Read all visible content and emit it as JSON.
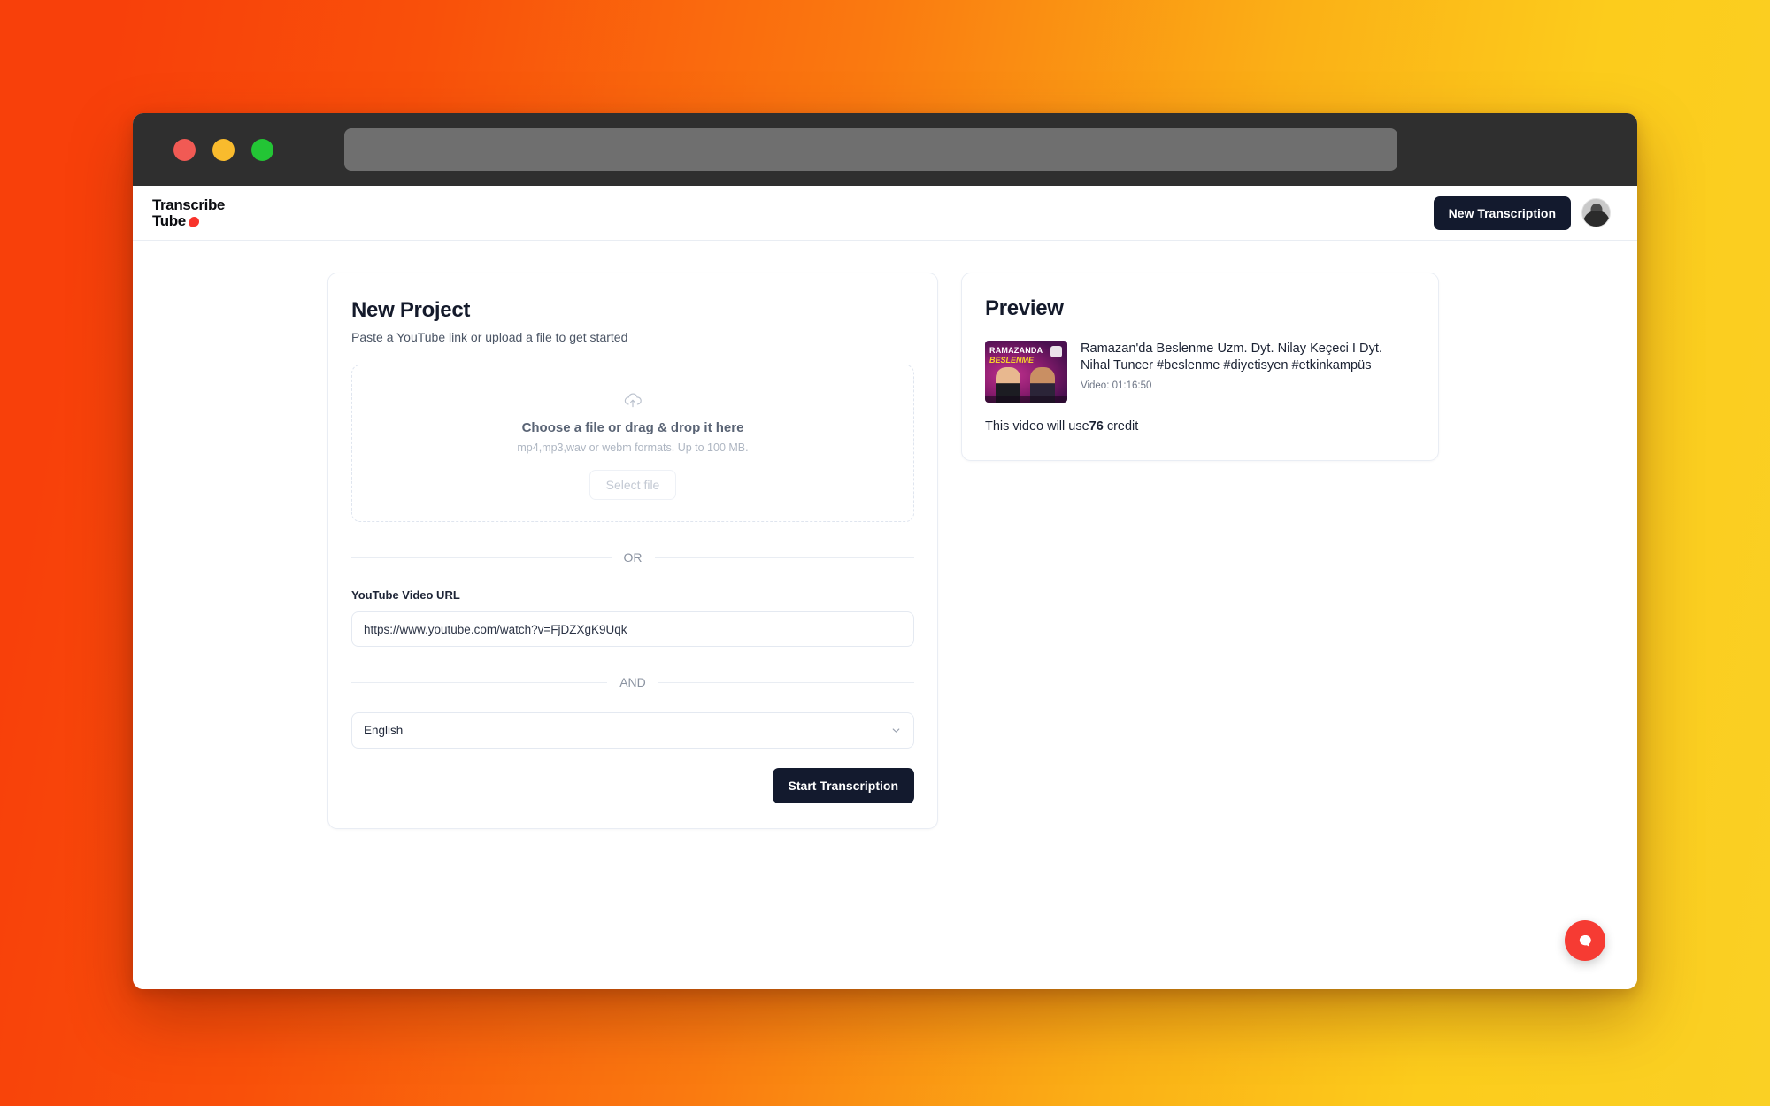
{
  "window": {
    "traffic_lights": [
      "close",
      "minimize",
      "maximize"
    ],
    "url_value": ""
  },
  "header": {
    "logo_line1": "Transcribe",
    "logo_line2": "Tube",
    "new_transcription_label": "New Transcription"
  },
  "new_project": {
    "title": "New Project",
    "subtitle": "Paste a YouTube link or upload a file to get started",
    "dropzone": {
      "icon": "cloud-upload-icon",
      "title": "Choose a file or drag & drop it here",
      "formats": "mp4,mp3,wav or webm formats. Up to 100 MB.",
      "select_button": "Select file"
    },
    "divider_or": "OR",
    "url_field": {
      "label": "YouTube Video URL",
      "value": "https://www.youtube.com/watch?v=FjDZXgK9Uqk",
      "placeholder": "https://www.youtube.com/watch?v="
    },
    "divider_and": "AND",
    "language_select": {
      "value": "English",
      "options": [
        "English"
      ]
    },
    "start_button": "Start Transcription"
  },
  "preview": {
    "title": "Preview",
    "thumbnail": {
      "line1": "RAMAZANDA",
      "line2": "BESLENME"
    },
    "video_title": "Ramazan'da Beslenme Uzm. Dyt. Nilay Keçeci I Dyt. Nihal Tuncer #beslenme #diyetisyen #etkinkampüs",
    "duration_label": "Video: 01:16:50",
    "credit_prefix": "This video will use",
    "credit_amount": "76",
    "credit_suffix": " credit"
  },
  "chat_widget": {
    "icon": "chat-bubble-icon",
    "color": "#f63b33"
  },
  "colors": {
    "accent_dark": "#131a2e",
    "brand_red": "#f8332b",
    "background_gradient_start": "#f8400a",
    "background_gradient_end": "#fad024"
  }
}
